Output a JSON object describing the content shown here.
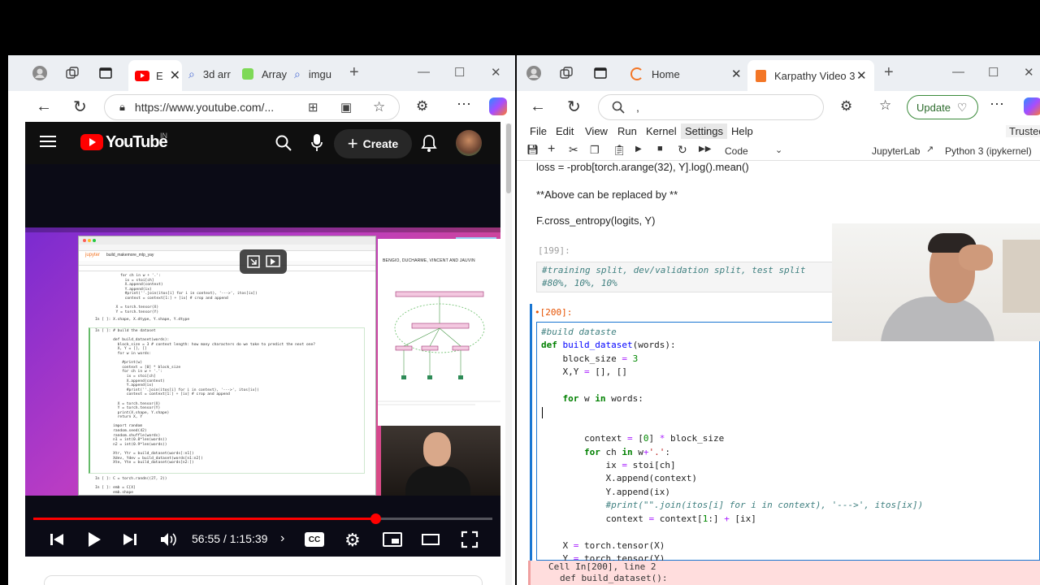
{
  "left_browser": {
    "tabs": [
      {
        "label": "E",
        "active": true
      },
      {
        "label": "3d arr",
        "active": false
      },
      {
        "label": "Array",
        "active": false
      },
      {
        "label": "imgu",
        "active": false
      }
    ],
    "url": "https://www.youtube.com/..."
  },
  "youtube": {
    "logo_text": "YouTube",
    "region": "IN",
    "create_label": "Create",
    "time_display": "56:55 / 1:15:39",
    "progress": 0.746,
    "cc_label": "CC",
    "video": {
      "jupyter_title": "jupyter",
      "notebook_name": "build_makemore_mlp_yay",
      "paper_heading": "BENGIO, DUCHARME, VINCENT AND JAUVIN"
    }
  },
  "right_browser": {
    "tabs": [
      {
        "label": "Home",
        "active": false
      },
      {
        "label": "Karpathy Video 3",
        "active": true
      }
    ],
    "address_text": ",",
    "update_label": "Update"
  },
  "jupyter": {
    "menu": [
      "File",
      "Edit",
      "View",
      "Run",
      "Kernel",
      "Settings",
      "Help"
    ],
    "trusted": "Trusted",
    "cell_type": "Code",
    "jupyterlab_label": "JupyterLab",
    "kernel": "Python 3 (ipykernel)",
    "md_lines": [
      "loss = -prob[torch.arange(32), Y].log().mean()",
      "**Above can be replaced by **",
      "F.cross_entropy(logits, Y)"
    ],
    "cell199": {
      "prompt": "[199]:",
      "lines": [
        "#training split, dev/validation split, test split",
        "#80%, 10%, 10%"
      ]
    },
    "cell200": {
      "prompt": "[200]:",
      "marker": "•"
    },
    "error": {
      "line1": "Cell In[200], line 2",
      "line2": "def build_dataset():"
    }
  },
  "colors": {
    "yt_red": "#ff0000",
    "jupyter_active_border": "#1976d2",
    "prompt_orange": "#e65100"
  }
}
